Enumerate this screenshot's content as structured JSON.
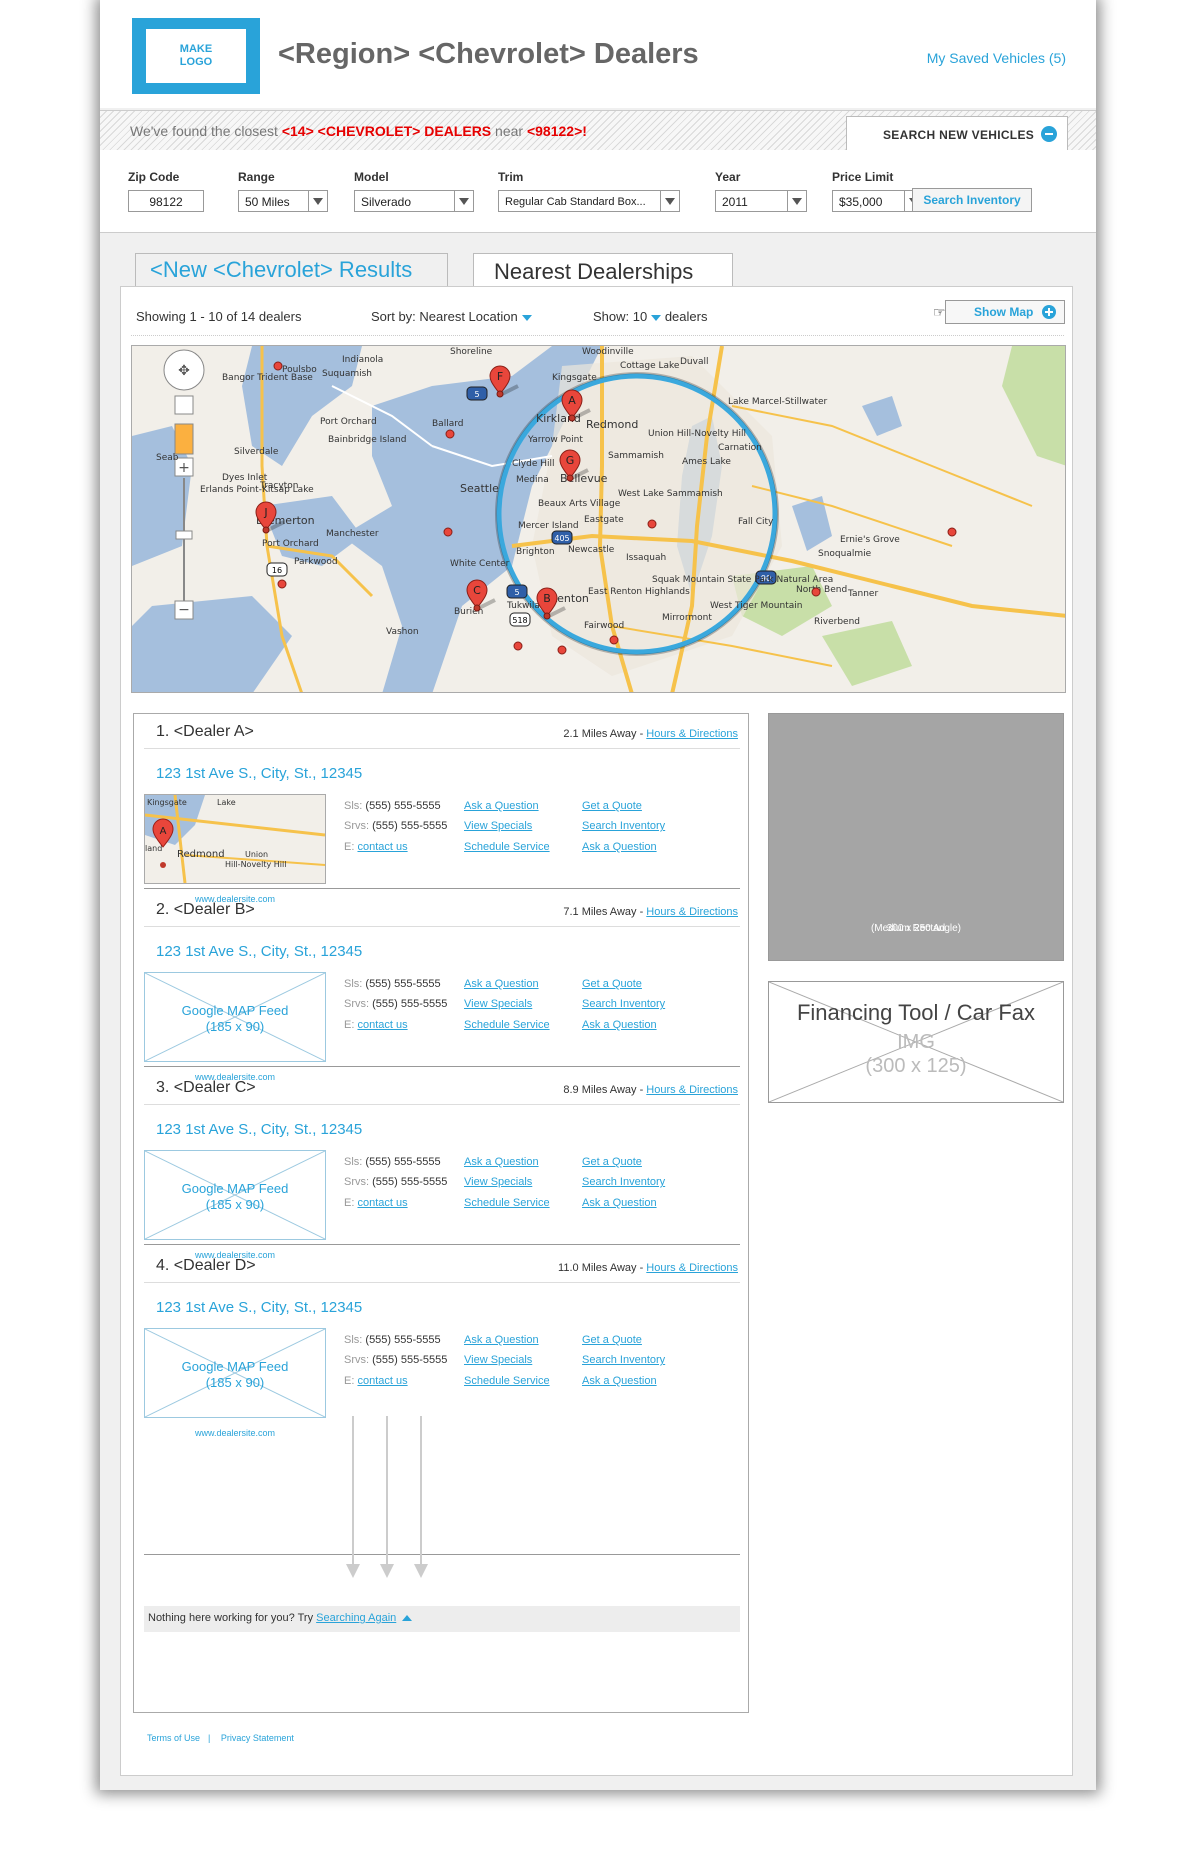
{
  "header": {
    "logo_text": "MAKE LOGO",
    "title": "<Region> <Chevrolet> Dealers",
    "saved_vehicles": "My Saved Vehicles (5)"
  },
  "found_bar": {
    "prefix": "We've found the closest ",
    "count": "<14>",
    "make": "<CHEVROLET> DEALERS",
    "near": " near ",
    "zip": "<98122>!",
    "search_tab_label": "SEARCH NEW VEHICLES"
  },
  "search_form": {
    "zip_label": "Zip Code",
    "zip_value": "98122",
    "range_label": "Range",
    "range_value": "50 Miles",
    "model_label": "Model",
    "model_value": "Silverado",
    "trim_label": "Trim",
    "trim_value": "Regular Cab Standard Box...",
    "year_label": "Year",
    "year_value": "2011",
    "price_label": "Price Limit",
    "price_value": "$35,000",
    "search_button": "Search Inventory"
  },
  "tabs": {
    "results": "<New <Chevrolet> Results",
    "nearest": "Nearest Dealerships"
  },
  "toolbar": {
    "showing": "Showing 1 - 10 of 14 dealers",
    "sort": "Sort by: Nearest Location",
    "show_prefix": "Show: 10",
    "show_suffix": "dealers",
    "show_map": "Show Map"
  },
  "map": {
    "labels": [
      "Shoreline",
      "Woodinville",
      "Kingsgate",
      "Cottage Lake",
      "Duvall",
      "Indianola",
      "Poulsbo",
      "Suquamish",
      "Bangor Trident Base",
      "Port Orchard",
      "Bainbridge Island",
      "Kirkland",
      "Redmond",
      "Silverdale",
      "Yarrow Point",
      "Sammamish",
      "Seattle",
      "Clyde Hill",
      "Medina",
      "Bellevue",
      "Tracyton",
      "West Lake Sammamish",
      "Beaux Arts Village",
      "Eastgate",
      "Bremerton",
      "Manchester",
      "Mercer Island",
      "Issaquah",
      "Port Orchard",
      "Parkwood",
      "Newcastle",
      "White Center",
      "Burien",
      "Tukwila",
      "Renton",
      "East Renton Highlands",
      "Vashon",
      "Carnation",
      "Fall City",
      "Snoqualmie",
      "Ames Lake",
      "Lake Marcel-Stillwater",
      "Union Hill-Novelty Hill",
      "Squak Mountain State Park Natural Area",
      "North Bend",
      "Riverbend",
      "West Tiger Mountain",
      "Mirrormont",
      "Erlands Point-Kitsap Lake",
      "Dyes Inlet",
      "Ballard",
      "Brighton",
      "Fairwood",
      "Ernie's Grove",
      "Tanner",
      "Seab"
    ],
    "markers": [
      "F",
      "A",
      "G",
      "J",
      "C",
      "B"
    ],
    "route_shields": [
      "5",
      "405",
      "16",
      "5",
      "518",
      "90"
    ]
  },
  "dealers": [
    {
      "name": "1. <Dealer A>",
      "distance": "2.1 Miles Away",
      "hours_link": "Hours & Directions",
      "address": "123 1st Ave S., City, St., 12345",
      "thumb_type": "map",
      "thumb_labels": [
        "Kingsgate",
        "Lake",
        "Redmond",
        "Union",
        "Hill-Novelty Hill",
        "land"
      ],
      "thumb_marker": "A",
      "site": "www.dealersite.com",
      "sales_label": "Sls:",
      "sales_phone": "(555) 555-5555",
      "service_label": "Srvs:",
      "service_phone": "(555) 555-5555",
      "email_label": "E:",
      "email_link": "contact us",
      "links_col1": [
        "Ask a Question",
        "View Specials",
        "Schedule Service"
      ],
      "links_col2": [
        "Get a Quote",
        "Search Inventory",
        "Ask a Question"
      ]
    },
    {
      "name": "2. <Dealer B>",
      "distance": "7.1 Miles Away",
      "hours_link": "Hours & Directions",
      "address": "123 1st Ave S., City, St., 12345",
      "thumb_type": "placeholder",
      "thumb_text": "Google MAP Feed",
      "thumb_size": "(185 x 90)",
      "site": "www.dealersite.com",
      "sales_label": "Sls:",
      "sales_phone": "(555) 555-5555",
      "service_label": "Srvs:",
      "service_phone": "(555) 555-5555",
      "email_label": "E:",
      "email_link": "contact us",
      "links_col1": [
        "Ask a Question",
        "View Specials",
        "Schedule Service"
      ],
      "links_col2": [
        "Get a Quote",
        "Search Inventory",
        "Ask a Question"
      ]
    },
    {
      "name": "3. <Dealer C>",
      "distance": "8.9 Miles Away",
      "hours_link": "Hours & Directions",
      "address": "123 1st Ave S., City, St., 12345",
      "thumb_type": "placeholder",
      "thumb_text": "Google MAP Feed",
      "thumb_size": "(185 x 90)",
      "site": "www.dealersite.com",
      "sales_label": "Sls:",
      "sales_phone": "(555) 555-5555",
      "service_label": "Srvs:",
      "service_phone": "(555) 555-5555",
      "email_label": "E:",
      "email_link": "contact us",
      "links_col1": [
        "Ask a Question",
        "View Specials",
        "Schedule Service"
      ],
      "links_col2": [
        "Get a Quote",
        "Search Inventory",
        "Ask a Question"
      ]
    },
    {
      "name": "4. <Dealer D>",
      "distance": "11.0 Miles Away",
      "hours_link": "Hours & Directions",
      "address": "123 1st Ave S., City, St., 12345",
      "thumb_type": "placeholder",
      "thumb_text": "Google MAP Feed",
      "thumb_size": "(185 x 90)",
      "site": "www.dealersite.com",
      "sales_label": "Sls:",
      "sales_phone": "(555) 555-5555",
      "service_label": "Srvs:",
      "service_phone": "(555) 555-5555",
      "email_label": "E:",
      "email_link": "contact us",
      "links_col1": [
        "Ask a Question",
        "View Specials",
        "Schedule Service"
      ],
      "links_col2": [
        "Get a Quote",
        "Search Inventory",
        "Ask a Question"
      ]
    }
  ],
  "list_footer": {
    "prompt": "Nothing here working for you? Try ",
    "link": "Searching Again"
  },
  "ads": {
    "medium_rect": "300 x 250 Ad",
    "medium_rect_sub": "(Medium Rectangle)",
    "fin_title": "Financing Tool / Car Fax",
    "fin_img": "IMG",
    "fin_size": "(300 x 125)"
  },
  "footer": {
    "terms": "Terms of Use",
    "sep": "|",
    "privacy": "Privacy Statement"
  },
  "colors": {
    "accent": "#29a3d9",
    "highlight_red": "#e60000",
    "ad_gray": "#a5a5a5",
    "water": "#a5bfdd",
    "land": "#f2efe9",
    "park": "#c8dfa8",
    "road": "#f6c24b"
  }
}
